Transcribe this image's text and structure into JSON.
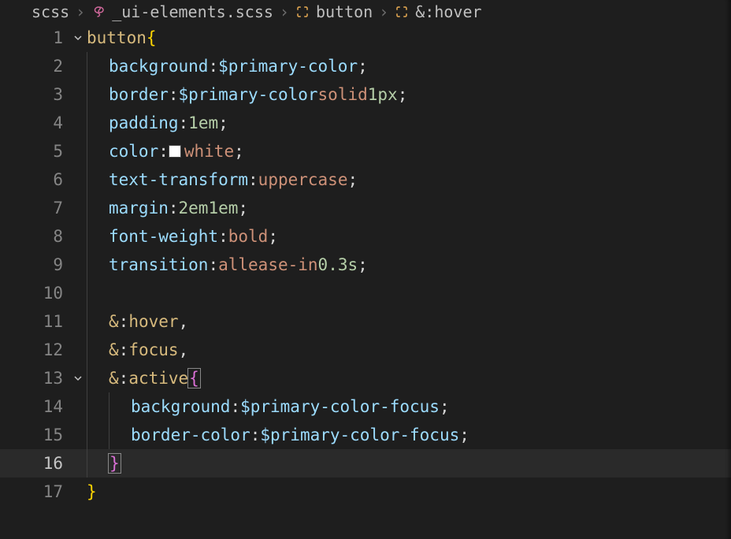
{
  "breadcrumb": {
    "items": [
      {
        "label": "scss",
        "icon": null
      },
      {
        "label": "_ui-elements.scss",
        "icon": "scss-file-icon"
      },
      {
        "label": "button",
        "icon": "symbol-rule-icon"
      },
      {
        "label": "&:hover",
        "icon": "symbol-rule-icon"
      }
    ],
    "separator": "›"
  },
  "editor": {
    "current_line": 16,
    "lines": [
      {
        "num": 1,
        "fold": true,
        "indent": 0,
        "tokens": [
          [
            "selector",
            "button"
          ],
          [
            "ws",
            " "
          ],
          [
            "brace-yellow",
            "{"
          ]
        ]
      },
      {
        "num": 2,
        "fold": false,
        "indent": 1,
        "tokens": [
          [
            "prop",
            "background"
          ],
          [
            "punct",
            ":"
          ],
          [
            "ws",
            " "
          ],
          [
            "var",
            "$primary-color"
          ],
          [
            "punct",
            ";"
          ]
        ]
      },
      {
        "num": 3,
        "fold": false,
        "indent": 1,
        "tokens": [
          [
            "prop",
            "border"
          ],
          [
            "punct",
            ":"
          ],
          [
            "ws",
            " "
          ],
          [
            "var",
            "$primary-color"
          ],
          [
            "ws",
            " "
          ],
          [
            "value",
            "solid"
          ],
          [
            "ws",
            " "
          ],
          [
            "num",
            "1px"
          ],
          [
            "punct",
            ";"
          ]
        ]
      },
      {
        "num": 4,
        "fold": false,
        "indent": 1,
        "tokens": [
          [
            "prop",
            "padding"
          ],
          [
            "punct",
            ":"
          ],
          [
            "ws",
            " "
          ],
          [
            "num",
            "1em"
          ],
          [
            "punct",
            ";"
          ]
        ]
      },
      {
        "num": 5,
        "fold": false,
        "indent": 1,
        "tokens": [
          [
            "prop",
            "color"
          ],
          [
            "punct",
            ":"
          ],
          [
            "ws",
            " "
          ],
          [
            "swatch",
            ""
          ],
          [
            "value",
            "white"
          ],
          [
            "punct",
            ";"
          ]
        ]
      },
      {
        "num": 6,
        "fold": false,
        "indent": 1,
        "tokens": [
          [
            "prop",
            "text-transform"
          ],
          [
            "punct",
            ":"
          ],
          [
            "ws",
            " "
          ],
          [
            "value",
            "uppercase"
          ],
          [
            "punct",
            ";"
          ]
        ]
      },
      {
        "num": 7,
        "fold": false,
        "indent": 1,
        "tokens": [
          [
            "prop",
            "margin"
          ],
          [
            "punct",
            ":"
          ],
          [
            "ws",
            " "
          ],
          [
            "num",
            "2em"
          ],
          [
            "ws",
            " "
          ],
          [
            "num",
            "1em"
          ],
          [
            "punct",
            ";"
          ]
        ]
      },
      {
        "num": 8,
        "fold": false,
        "indent": 1,
        "tokens": [
          [
            "prop",
            "font-weight"
          ],
          [
            "punct",
            ":"
          ],
          [
            "ws",
            " "
          ],
          [
            "value",
            "bold"
          ],
          [
            "punct",
            ";"
          ]
        ]
      },
      {
        "num": 9,
        "fold": false,
        "indent": 1,
        "tokens": [
          [
            "prop",
            "transition"
          ],
          [
            "punct",
            ":"
          ],
          [
            "ws",
            " "
          ],
          [
            "value",
            "all"
          ],
          [
            "ws",
            " "
          ],
          [
            "value",
            "ease-in"
          ],
          [
            "ws",
            " "
          ],
          [
            "num",
            "0.3s"
          ],
          [
            "punct",
            ";"
          ]
        ]
      },
      {
        "num": 10,
        "fold": false,
        "indent": 1,
        "tokens": []
      },
      {
        "num": 11,
        "fold": false,
        "indent": 1,
        "tokens": [
          [
            "amp",
            "&"
          ],
          [
            "punct",
            ":"
          ],
          [
            "pseudo",
            "hover"
          ],
          [
            "punct",
            ","
          ]
        ]
      },
      {
        "num": 12,
        "fold": false,
        "indent": 1,
        "tokens": [
          [
            "amp",
            "&"
          ],
          [
            "punct",
            ":"
          ],
          [
            "pseudo",
            "focus"
          ],
          [
            "punct",
            ","
          ]
        ]
      },
      {
        "num": 13,
        "fold": true,
        "indent": 1,
        "tokens": [
          [
            "amp",
            "&"
          ],
          [
            "punct",
            ":"
          ],
          [
            "pseudo",
            "active"
          ],
          [
            "ws",
            " "
          ],
          [
            "brace-pink-match",
            "{"
          ]
        ]
      },
      {
        "num": 14,
        "fold": false,
        "indent": 2,
        "tokens": [
          [
            "prop",
            "background"
          ],
          [
            "punct",
            ":"
          ],
          [
            "ws",
            " "
          ],
          [
            "var",
            "$primary-color-focus"
          ],
          [
            "punct",
            ";"
          ]
        ]
      },
      {
        "num": 15,
        "fold": false,
        "indent": 2,
        "tokens": [
          [
            "prop",
            "border-color"
          ],
          [
            "punct",
            ":"
          ],
          [
            "ws",
            " "
          ],
          [
            "var",
            "$primary-color-focus"
          ],
          [
            "punct",
            ";"
          ]
        ]
      },
      {
        "num": 16,
        "fold": false,
        "indent": 1,
        "tokens": [
          [
            "brace-pink-match",
            "}"
          ]
        ]
      },
      {
        "num": 17,
        "fold": false,
        "indent": 0,
        "tokens": [
          [
            "brace-yellow",
            "}"
          ]
        ]
      }
    ]
  }
}
